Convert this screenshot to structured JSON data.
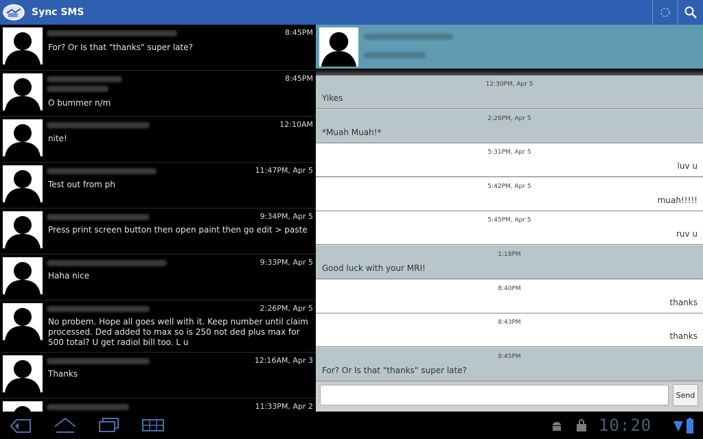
{
  "app": {
    "title": "Sync SMS"
  },
  "conversations": [
    {
      "time": "8:45PM",
      "message": "For? Or Is that \"thanks\" super late?"
    },
    {
      "time": "8:45PM",
      "message": "O bummer n/m"
    },
    {
      "time": "12:10AM",
      "message": "nite!"
    },
    {
      "time": "11:47PM, Apr 5",
      "message": "Test out from ph"
    },
    {
      "time": "9:34PM, Apr 5",
      "message": "Press print screen button then open paint then go edit > paste"
    },
    {
      "time": "9:33PM, Apr 5",
      "message": "Haha nice"
    },
    {
      "time": "2:26PM, Apr 5",
      "message": "No probem. Hope all goes well with it. Keep number until claim processed. Ded added to max so is 250 not ded plus max for 500 total? U get radiol bill too. L u"
    },
    {
      "time": "12:16AM, Apr 3",
      "message": "Thanks"
    },
    {
      "time": "11:33PM, Apr 2",
      "message": ""
    }
  ],
  "thread": [
    {
      "time": "12:30PM, Apr 5",
      "text": "Yikes",
      "direction": "in"
    },
    {
      "time": "2:26PM, Apr 5",
      "text": "*Muah Muah!*",
      "direction": "in"
    },
    {
      "time": "5:31PM, Apr 5",
      "text": "luv u",
      "direction": "out"
    },
    {
      "time": "5:42PM, Apr 5",
      "text": "muah!!!!!",
      "direction": "out"
    },
    {
      "time": "5:45PM, Apr 5",
      "text": "ruv u",
      "direction": "out"
    },
    {
      "time": "1:18PM",
      "text": "Good luck with your MRI!",
      "direction": "in"
    },
    {
      "time": "8:40PM",
      "text": "thanks",
      "direction": "out"
    },
    {
      "time": "8:43PM",
      "text": "thanks",
      "direction": "out"
    },
    {
      "time": "8:45PM",
      "text": "For? Or Is that \"thanks\" super late?",
      "direction": "in"
    }
  ],
  "compose": {
    "value": "",
    "send_label": "Send"
  },
  "system_bar": {
    "clock": "10:20"
  },
  "icons": {
    "back": "back-icon",
    "home": "home-icon",
    "recent": "recent-apps-icon",
    "menu": "menu-grid-icon",
    "android": "android-debug-icon",
    "shop": "shopping-bag-icon",
    "wifi": "wifi-icon",
    "battery": "battery-icon",
    "search": "search-icon",
    "sync": "sync-spinner-icon"
  },
  "colors": {
    "action_bar": "#2f5fb0",
    "header": "#5f9cb2",
    "incoming": "#b8c6c9",
    "outgoing": "#ffffff"
  }
}
